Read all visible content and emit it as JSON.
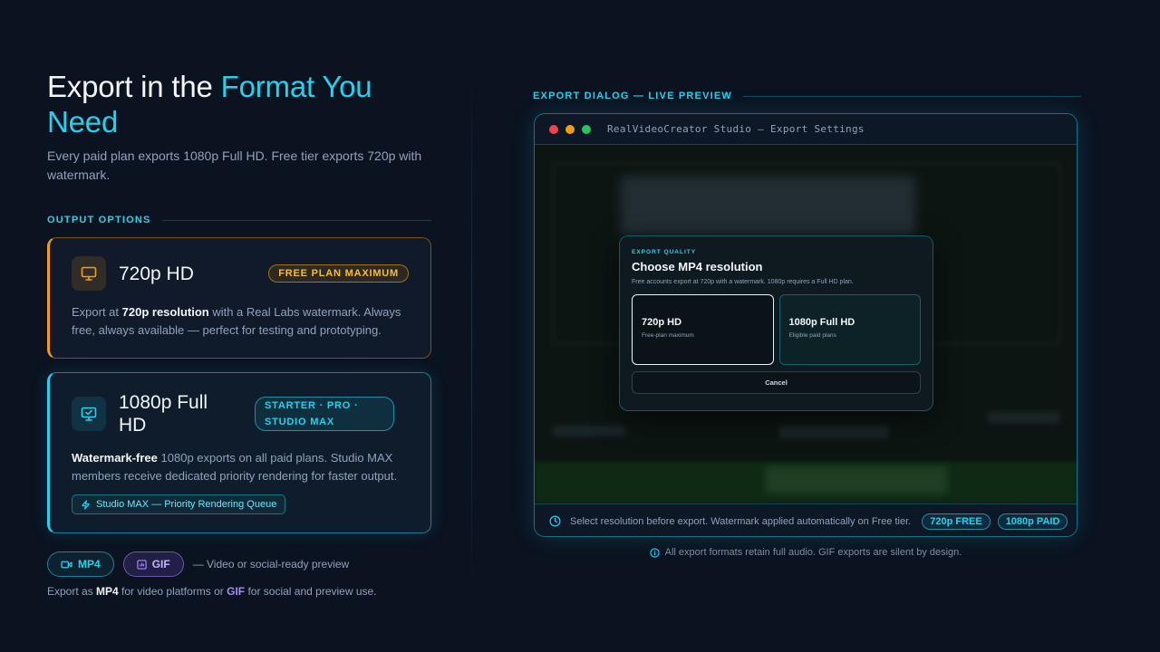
{
  "left": {
    "headline_plain": "Export in the",
    "headline_accent": "Format You Need",
    "subtitle": "Every paid plan exports 1080p Full HD. Free tier exports 720p with watermark.",
    "section_label": "OUTPUT OPTIONS",
    "free_card": {
      "icon": "monitor-icon",
      "title": "720p HD",
      "badge": "FREE PLAN MAXIMUM",
      "desc_pre": "Export at ",
      "desc_bold": "720p resolution",
      "desc_post": " with a Real Labs watermark. Always free, always available — perfect for testing and prototyping.",
      "accent": "#f59e0b"
    },
    "hd_card": {
      "icon": "monitor-check-icon",
      "title": "1080p Full HD",
      "badge": "STARTER · PRO · STUDIO MAX",
      "desc_bold": "Watermark-free",
      "desc_post": " 1080p exports on all paid plans. Studio MAX members receive dedicated priority rendering for faster output.",
      "priority_label": "Studio MAX — Priority Rendering Queue",
      "accent": "#22d3ee"
    },
    "formats": {
      "mp4_label": "MP4",
      "gif_label": "GIF",
      "note": "— Video or social-ready preview",
      "desc_pre": "Export as ",
      "desc_mp4": "MP4",
      "desc_mid": " for video platforms or ",
      "desc_gif": "GIF",
      "desc_post": " for social and preview use."
    }
  },
  "right": {
    "section_label": "EXPORT DIALOG — LIVE PREVIEW",
    "window_title": "RealVideoCreator Studio — Export Settings",
    "dialog": {
      "eyebrow": "EXPORT QUALITY",
      "title": "Choose MP4 resolution",
      "subtitle": "Free accounts export at 720p with a watermark. 1080p requires a Full HD plan.",
      "options": [
        {
          "title": "720p HD",
          "sub": "Free-plan maximum",
          "selected": true
        },
        {
          "title": "1080p Full HD",
          "sub": "Eligible paid plans",
          "selected": false
        }
      ],
      "cancel_label": "Cancel"
    },
    "status": {
      "text": "Select resolution before export. Watermark applied automatically on Free tier.",
      "tag_free": "720p FREE",
      "tag_paid": "1080p PAID"
    },
    "footnote": "All export formats retain full audio. GIF exports are silent by design."
  },
  "colors": {
    "accent": "#22d3ee",
    "warning": "#f59e0b",
    "gif": "#a78bfa",
    "background": "#0b1220"
  }
}
